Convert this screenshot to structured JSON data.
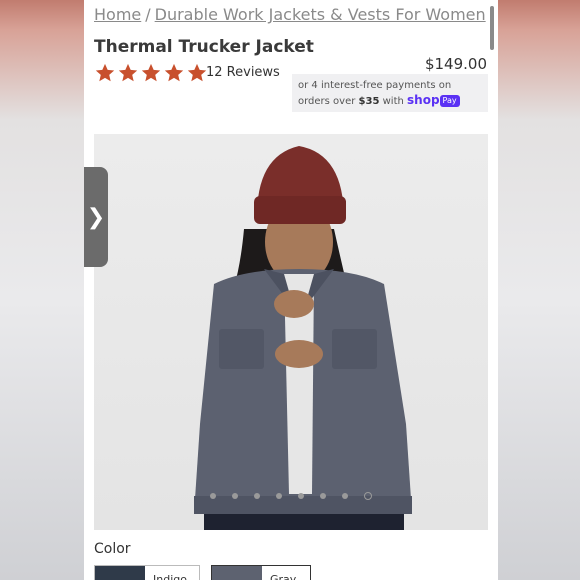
{
  "breadcrumb": {
    "home": "Home",
    "separator": "/",
    "category": "Durable Work Jackets & Vests For Women"
  },
  "product": {
    "title": "Thermal Trucker Jacket",
    "rating": 5,
    "reviews": "12 Reviews",
    "price": "$149.00"
  },
  "shoppay": {
    "line1": "or 4 interest-free payments on",
    "prefix": "orders over",
    "amount": "$35",
    "with": "with",
    "shop": "shop",
    "pay": "Pay"
  },
  "gallery": {
    "dot_count": 8,
    "active_index": 7
  },
  "side_tab": {
    "glyph": "❯"
  },
  "color": {
    "label": "Color",
    "options": [
      {
        "label": "Indigo"
      },
      {
        "label": "Gray"
      }
    ]
  },
  "colors": {
    "star": "#c8502d",
    "beanie": "#7a2e2a",
    "jacket": "#5c6170",
    "shoppay": "#5a31f4"
  }
}
